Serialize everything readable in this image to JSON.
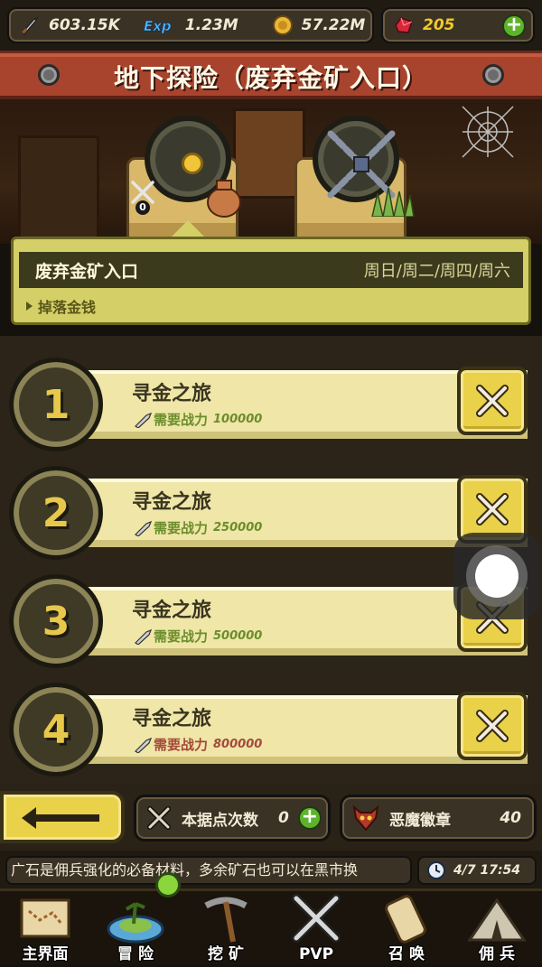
{
  "topbar": {
    "power": "603.15K",
    "exp_label": "Exp",
    "exp": "1.23M",
    "gold": "57.22M",
    "gems": "205",
    "plus": "+"
  },
  "header": {
    "title": "地下探险（废弃金矿入口）"
  },
  "info": {
    "location_name": "废弃金矿入口",
    "schedule": "周日/周二/周四/周六",
    "drop": "掉落金钱",
    "lock_count": "0"
  },
  "stages": [
    {
      "num": "1",
      "name": "寻金之旅",
      "req_label": "需要战力",
      "power": "100000"
    },
    {
      "num": "2",
      "name": "寻金之旅",
      "req_label": "需要战力",
      "power": "250000"
    },
    {
      "num": "3",
      "name": "寻金之旅",
      "req_label": "需要战力",
      "power": "500000"
    },
    {
      "num": "4",
      "name": "寻金之旅",
      "req_label": "需要战力",
      "power": "800000"
    }
  ],
  "bottom": {
    "count_label": "本据点次数",
    "count_value": "0",
    "badge_label": "恶魔徽章",
    "badge_value": "40"
  },
  "ticker": {
    "text": "广石是佣兵强化的必备材料，多余矿石也可以在黑市换",
    "time": "4/7 17:54"
  },
  "nav": [
    {
      "label": "主界面"
    },
    {
      "label": "冒 险"
    },
    {
      "label": "挖 矿"
    },
    {
      "label": "PVP"
    },
    {
      "label": "召 唤"
    },
    {
      "label": "佣 兵"
    }
  ],
  "colors": {
    "banner": "#a8442e",
    "panel": "#d4cf66",
    "stage_bar": "#efe6a8",
    "button": "#e9d14a",
    "req_green": "#6a8e2a",
    "req_red": "#a34a3a"
  }
}
